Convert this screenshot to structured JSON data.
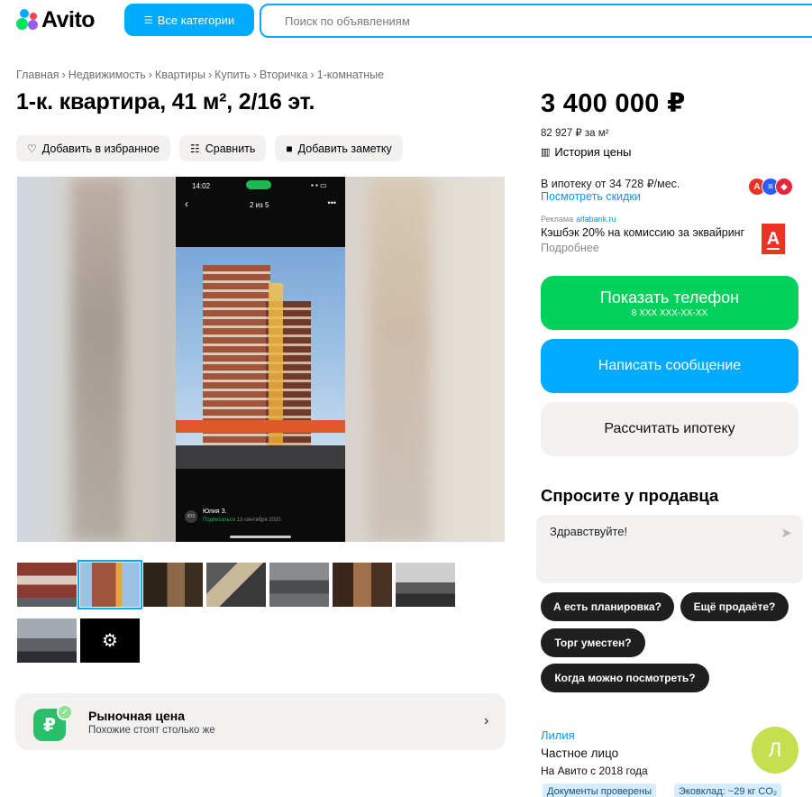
{
  "header": {
    "logo_text": "Avito",
    "categories_label": "Все категории",
    "search_placeholder": "Поиск по объявлениям"
  },
  "breadcrumb": [
    "Главная",
    "Недвижимость",
    "Квартиры",
    "Купить",
    "Вторичка",
    "1-комнатные"
  ],
  "title": "1-к. квартира, 41 м², 2/16 эт.",
  "actions": {
    "favorite": "Добавить в избранное",
    "compare": "Сравнить",
    "note": "Добавить заметку"
  },
  "photo": {
    "status_time": "14:02",
    "counter": "2 из 5",
    "user_initials": "ЮЗ",
    "user_name": "Юлия З.",
    "user_follow": "Подписаться",
    "user_date": "13 сентября 2020"
  },
  "thumbnails_count": 9,
  "market": {
    "title": "Рыночная цена",
    "subtitle": "Похожие стоят столько же"
  },
  "price": {
    "value": "3 400 000 ₽",
    "per_meter": "82 927 ₽ за м²",
    "history": "История цены"
  },
  "mortgage": {
    "text": "В ипотеку от 34 728 ₽/мес.",
    "link": "Посмотреть скидки"
  },
  "ad": {
    "label": "Реклама",
    "domain": "alfabank.ru",
    "text": "Кэшбэк 20% на комиссию за эквайринг",
    "more": "Подробнее"
  },
  "buttons": {
    "phone": "Показать телефон",
    "phone_mask": "8 XXX XXX-XX-XX",
    "message": "Написать сообщение",
    "mortgage": "Рассчитать ипотеку"
  },
  "ask": {
    "title": "Спросите у продавца",
    "message": "Здравствуйте!",
    "chips": [
      "А есть планировка?",
      "Ещё продаёте?",
      "Торг уместен?",
      "Когда можно посмотреть?"
    ]
  },
  "seller": {
    "name": "Лилия",
    "type": "Частное лицо",
    "since": "На Авито с 2018 года",
    "avatar_letter": "Л",
    "tags": [
      "Документы проверены",
      "Эковклад: ~29 кг CO₂"
    ]
  },
  "colors": {
    "accent_blue": "#00aaff",
    "phone_green": "#02d15c",
    "link_blue": "#0099f7",
    "chip_dark": "#1f1f1f"
  }
}
